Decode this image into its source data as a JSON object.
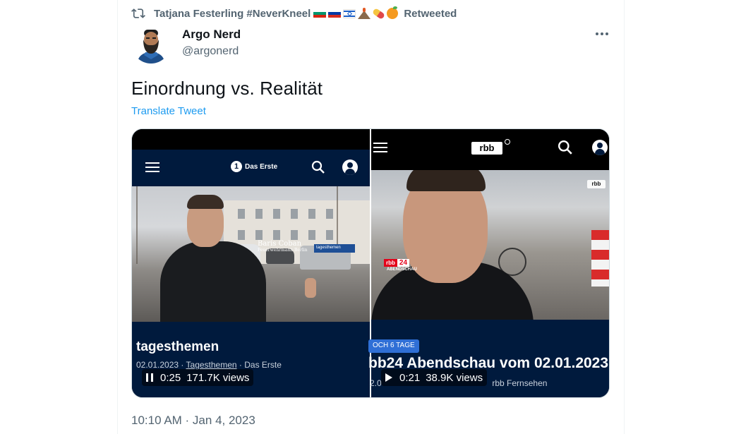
{
  "retweet": {
    "retweeter": "Tatjana Festerling #NeverKneel",
    "label": "Retweeted"
  },
  "author": {
    "name": "Argo Nerd",
    "handle": "@argonerd"
  },
  "tweet": {
    "text": "Einordnung vs. Realität",
    "translate": "Translate Tweet",
    "timestamp": "10:10 AM · Jan 4, 2023"
  },
  "video_left": {
    "channel_logo": "Das Erste",
    "channel_logo_number": "1",
    "lower_third_name": "Baris Coban",
    "lower_third_role": "Feuerwehrmann Berlin",
    "lower_third_tag": "tagesthemen",
    "title": "tagesthemen",
    "meta_date": "02.01.2023",
    "meta_show": "Tagesthemen",
    "meta_channel": "Das Erste",
    "time": "0:25",
    "views": "171.7K views"
  },
  "video_right": {
    "channel_logo": "rbb",
    "corner_logo": "rbb",
    "badge_a": "rbb",
    "badge_b": "24",
    "badge_sub": "ABENDSCHAU",
    "chip": "OCH 6 TAGE",
    "title": "bb24 Abendschau vom 02.01.2023",
    "meta_prefix": "2.0",
    "meta_channel": "rbb Fernsehen",
    "time": "0:21",
    "views": "38.9K views"
  },
  "colors": {
    "link": "#1d9bf0",
    "secondary_text": "#536471",
    "video_panel": "#001a3d"
  }
}
